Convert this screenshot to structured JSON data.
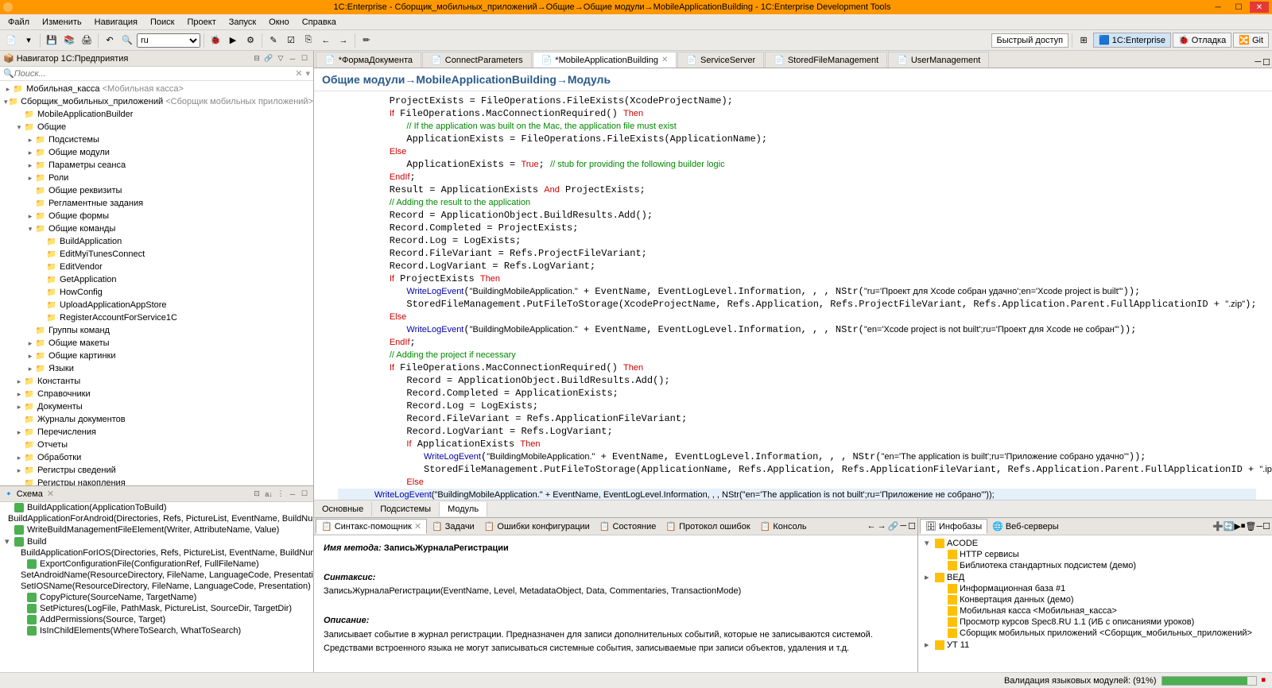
{
  "title": "1C:Enterprise - Сборщик_мобильных_приложений→Общие→Общие модули→MobileApplicationBuilding - 1C:Enterprise Development Tools",
  "menu": [
    "Файл",
    "Изменить",
    "Навигация",
    "Поиск",
    "Проект",
    "Запуск",
    "Окно",
    "Справка"
  ],
  "toolbar": {
    "lang": "ru",
    "quick_access": "Быстрый доступ",
    "perspectives": [
      "1C:Enterprise",
      "Отладка",
      "Git"
    ]
  },
  "navigator": {
    "title": "Навигатор 1С:Предприятия",
    "search_placeholder": "Поиск...",
    "tree": [
      {
        "indent": 0,
        "toggle": "▸",
        "label": "Мобильная_касса",
        "hint": " <Мобильная касса>"
      },
      {
        "indent": 0,
        "toggle": "▾",
        "label": "Сборщик_мобильных_приложений",
        "hint": " <Сборщик мобильных приложений>"
      },
      {
        "indent": 1,
        "toggle": "",
        "label": "MobileApplicationBuilder"
      },
      {
        "indent": 1,
        "toggle": "▾",
        "label": "Общие"
      },
      {
        "indent": 2,
        "toggle": "▸",
        "label": "Подсистемы"
      },
      {
        "indent": 2,
        "toggle": "▸",
        "label": "Общие модули"
      },
      {
        "indent": 2,
        "toggle": "▸",
        "label": "Параметры сеанса"
      },
      {
        "indent": 2,
        "toggle": "▸",
        "label": "Роли"
      },
      {
        "indent": 2,
        "toggle": "",
        "label": "Общие реквизиты"
      },
      {
        "indent": 2,
        "toggle": "",
        "label": "Регламентные задания"
      },
      {
        "indent": 2,
        "toggle": "▸",
        "label": "Общие формы"
      },
      {
        "indent": 2,
        "toggle": "▾",
        "label": "Общие команды"
      },
      {
        "indent": 3,
        "toggle": "",
        "label": "BuildApplication"
      },
      {
        "indent": 3,
        "toggle": "",
        "label": "EditMyiTunesConnect"
      },
      {
        "indent": 3,
        "toggle": "",
        "label": "EditVendor"
      },
      {
        "indent": 3,
        "toggle": "",
        "label": "GetApplication"
      },
      {
        "indent": 3,
        "toggle": "",
        "label": "HowConfig"
      },
      {
        "indent": 3,
        "toggle": "",
        "label": "UploadApplicationAppStore"
      },
      {
        "indent": 3,
        "toggle": "",
        "label": "RegisterAccountForService1C"
      },
      {
        "indent": 2,
        "toggle": "",
        "label": "Группы команд"
      },
      {
        "indent": 2,
        "toggle": "▸",
        "label": "Общие макеты"
      },
      {
        "indent": 2,
        "toggle": "▸",
        "label": "Общие картинки"
      },
      {
        "indent": 2,
        "toggle": "▸",
        "label": "Языки"
      },
      {
        "indent": 1,
        "toggle": "▸",
        "label": "Константы"
      },
      {
        "indent": 1,
        "toggle": "▸",
        "label": "Справочники"
      },
      {
        "indent": 1,
        "toggle": "▸",
        "label": "Документы"
      },
      {
        "indent": 1,
        "toggle": "",
        "label": "Журналы документов"
      },
      {
        "indent": 1,
        "toggle": "▸",
        "label": "Перечисления"
      },
      {
        "indent": 1,
        "toggle": "",
        "label": "Отчеты"
      },
      {
        "indent": 1,
        "toggle": "▸",
        "label": "Обработки"
      },
      {
        "indent": 1,
        "toggle": "▸",
        "label": "Регистры сведений"
      },
      {
        "indent": 1,
        "toggle": "",
        "label": "Регистры накопления"
      }
    ]
  },
  "schema": {
    "title": "Схема",
    "items": [
      {
        "indent": 0,
        "label": "BuildApplication(ApplicationToBuild)"
      },
      {
        "indent": 0,
        "label": "BuildApplicationForAndroid(Directories, Refs, PictureList, EventName, BuildNumber)"
      },
      {
        "indent": 0,
        "label": "WriteBuildManagementFileElement(Writer, AttributeName, Value)"
      },
      {
        "indent": 0,
        "label": "Build",
        "toggle": "▾"
      },
      {
        "indent": 1,
        "label": "BuildApplicationForIOS(Directories, Refs, PictureList, EventName, BuildNumber)"
      },
      {
        "indent": 1,
        "label": "ExportConfigurationFile(ConfigurationRef, FullFileName)"
      },
      {
        "indent": 1,
        "label": "SetAndroidName(ResourceDirectory, FileName, LanguageCode, Presentation)"
      },
      {
        "indent": 1,
        "label": "SetIOSName(ResourceDirectory, FileName, LanguageCode, Presentation)"
      },
      {
        "indent": 1,
        "label": "CopyPicture(SourceName, TargetName)"
      },
      {
        "indent": 1,
        "label": "SetPictures(LogFile, PathMask, PictureList, SourceDir, TargetDir)"
      },
      {
        "indent": 1,
        "label": "AddPermissions(Source, Target)"
      },
      {
        "indent": 1,
        "label": "IsInChildElements(WhereToSearch, WhatToSearch)"
      }
    ]
  },
  "editor": {
    "tabs": [
      {
        "label": "*ФормаДокумента",
        "active": false
      },
      {
        "label": "ConnectParameters",
        "active": false
      },
      {
        "label": "*MobileApplicationBuilding",
        "active": true
      },
      {
        "label": "ServiceServer",
        "active": false
      },
      {
        "label": "StoredFileManagement",
        "active": false
      },
      {
        "label": "UserManagement",
        "active": false
      }
    ],
    "breadcrumb": "Общие модули→MobileApplicationBuilding→Модуль",
    "sub_tabs": [
      "Основные",
      "Подсистемы",
      "Модуль"
    ],
    "active_sub": "Модуль"
  },
  "bottom": {
    "tabs": [
      "Синтакс-помощник",
      "Задачи",
      "Ошибки конфигурации",
      "Состояние",
      "Протокол ошибок",
      "Консоль"
    ],
    "active": "Синтакс-помощник",
    "help": {
      "method_label": "Имя метода:",
      "method_name": "ЗаписьЖурналаРегистрации",
      "syntax_label": "Синтаксис:",
      "syntax": "ЗаписьЖурналаРегистрации(EventName, Level, MetadataObject, Data, Commentaries, TransactionMode)",
      "desc_label": "Описание:",
      "desc": "Записывает событие в журнал регистрации. Предназначен для записи дополнительных событий, которые не записываются системой. Средствами встроенного языка не могут записываться системные события, записываемые при записи объектов, удаления и т.д."
    }
  },
  "infobases": {
    "tabs": [
      "Инфобазы",
      "Веб-серверы"
    ],
    "items": [
      {
        "indent": 0,
        "label": "ACODE",
        "toggle": "▾"
      },
      {
        "indent": 1,
        "label": "HTTP сервисы"
      },
      {
        "indent": 1,
        "label": "Библиотека стандартных подсистем (демо)"
      },
      {
        "indent": 0,
        "label": "ВЕД",
        "toggle": "▸"
      },
      {
        "indent": 1,
        "label": "Информационная база #1"
      },
      {
        "indent": 1,
        "label": "Конвертация данных (демо)"
      },
      {
        "indent": 1,
        "label": "Мобильная касса <Мобильная_касса>"
      },
      {
        "indent": 1,
        "label": "Просмотр курсов Spec8.RU 1.1 (ИБ с описаниями уроков)"
      },
      {
        "indent": 1,
        "label": "Сборщик мобильных приложений <Сборщик_мобильных_приложений>"
      },
      {
        "indent": 0,
        "label": "УТ 11",
        "toggle": "▸"
      }
    ]
  },
  "status": {
    "text": "Валидация языковых модулей: (91%)"
  }
}
